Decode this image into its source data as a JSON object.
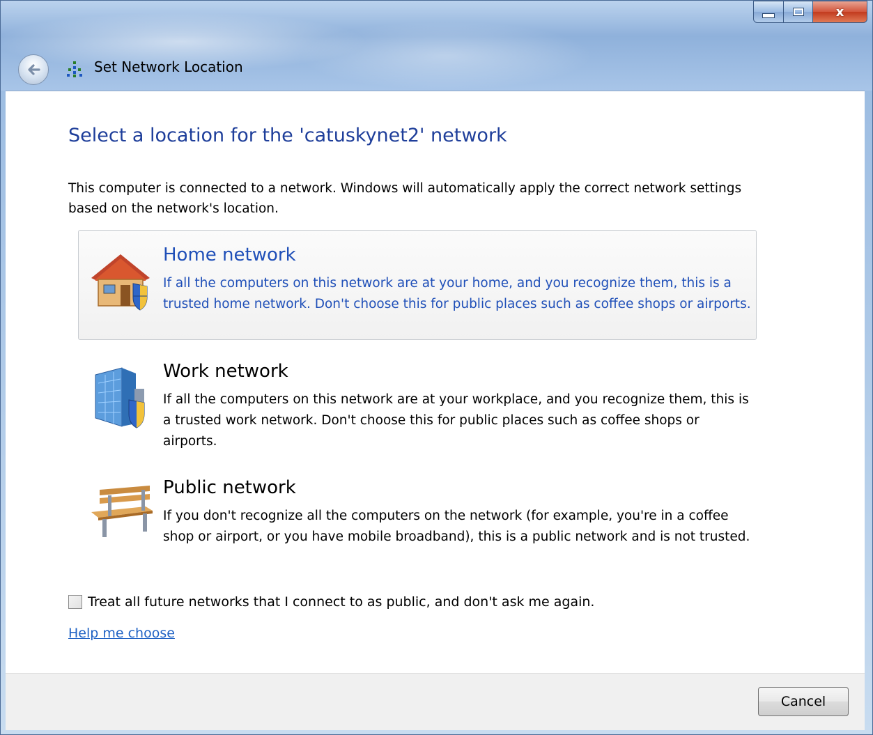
{
  "window": {
    "title": "Set Network Location",
    "caption_buttons": {
      "close_glyph": "x"
    }
  },
  "main": {
    "heading": "Select a location for the 'catuskynet2' network",
    "intro": "This computer is connected to a network. Windows will automatically apply the correct network settings based on the network's location.",
    "options": [
      {
        "title": "Home network",
        "description": "If all the computers on this network are at your home, and you recognize them, this is a trusted home network.  Don't choose this for public places such as coffee shops or airports.",
        "icon": "house-shield-icon",
        "selected": true
      },
      {
        "title": "Work network",
        "description": "If all the computers on this network are at your workplace, and you recognize them, this is a trusted work network.  Don't choose this for public places such as coffee shops or airports.",
        "icon": "office-building-shield-icon",
        "selected": false
      },
      {
        "title": "Public network",
        "description": "If you don't recognize all the computers on the network (for example, you're in a coffee shop or airport, or you have mobile broadband), this is a public network and is not trusted.",
        "icon": "park-bench-icon",
        "selected": false
      }
    ],
    "checkbox": {
      "label": "Treat all future networks that I connect to as public, and don't ask me again.",
      "checked": false
    },
    "help_link": "Help me choose"
  },
  "footer": {
    "cancel_label": "Cancel"
  },
  "colors": {
    "heading_blue": "#1e3e9a",
    "link_blue": "#1f62c4",
    "selected_text_blue": "#1f4fb8"
  }
}
